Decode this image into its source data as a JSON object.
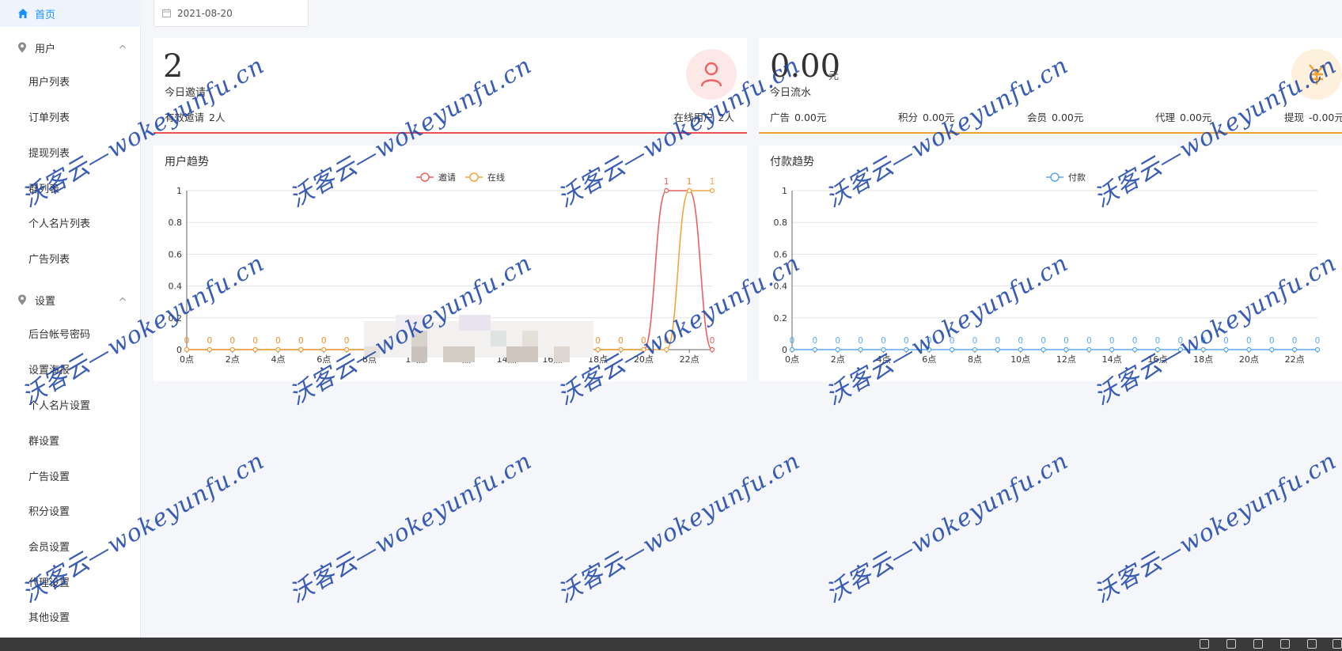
{
  "sidebar": {
    "home": "首页",
    "groups": [
      {
        "title": "用户",
        "items": [
          "用户列表",
          "订单列表",
          "提现列表",
          "群列表",
          "个人名片列表",
          "广告列表"
        ]
      },
      {
        "title": "设置",
        "items": [
          "后台帐号密码",
          "设置海报",
          "个人名片设置",
          "群设置",
          "广告设置",
          "积分设置",
          "会员设置",
          "代理设置",
          "其他设置"
        ]
      }
    ]
  },
  "date_picker": {
    "value": "2021-08-20",
    "icon": "calendar-icon"
  },
  "left_stat": {
    "value": "2",
    "label": "今日邀请",
    "rows": [
      {
        "label": "有效邀请",
        "value": "2人"
      },
      {
        "label": "在线用户",
        "value": "2人"
      }
    ],
    "icon": "user-icon",
    "accent": "#f05050"
  },
  "right_stat": {
    "value": "0.00",
    "unit": "元",
    "label": "今日流水",
    "rows": [
      {
        "label": "广告",
        "value": "0.00元"
      },
      {
        "label": "积分",
        "value": "0.00元"
      },
      {
        "label": "会员",
        "value": "0.00元"
      },
      {
        "label": "代理",
        "value": "0.00元"
      },
      {
        "label": "提现",
        "value": "-0.00元"
      }
    ],
    "icon": "yen-icon",
    "accent": "#f0a030"
  },
  "chart_data": [
    {
      "type": "line",
      "title": "用户趋势",
      "x": [
        "0点",
        "1点",
        "2点",
        "3点",
        "4点",
        "5点",
        "6点",
        "7点",
        "8点",
        "9点",
        "10点",
        "11点",
        "12点",
        "13点",
        "14点",
        "15点",
        "16点",
        "17点",
        "18点",
        "19点",
        "20点",
        "21点",
        "22点",
        "23点"
      ],
      "xticks": [
        "0点",
        "2点",
        "4点",
        "6点",
        "8点",
        "10点",
        "12点",
        "14点",
        "16点",
        "18点",
        "20点",
        "22点"
      ],
      "ylim": [
        0,
        1
      ],
      "yticks": [
        "0",
        "0.2",
        "0.4",
        "0.6",
        "0.8",
        "1"
      ],
      "legend": "top-center",
      "grid": true,
      "series": [
        {
          "name": "邀请",
          "color": "#e8625f",
          "values": [
            0,
            0,
            0,
            0,
            0,
            0,
            0,
            0,
            0,
            0,
            0,
            0,
            0,
            0,
            0,
            0,
            0,
            0,
            0,
            0,
            0,
            1,
            1,
            0
          ]
        },
        {
          "name": "在线",
          "color": "#f0a540",
          "values": [
            0,
            0,
            0,
            0,
            0,
            0,
            0,
            0,
            0,
            0,
            0,
            0,
            0,
            0,
            0,
            0,
            0,
            0,
            0,
            0,
            0,
            0,
            1,
            1
          ]
        }
      ]
    },
    {
      "type": "line",
      "title": "付款趋势",
      "x": [
        "0点",
        "1点",
        "2点",
        "3点",
        "4点",
        "5点",
        "6点",
        "7点",
        "8点",
        "9点",
        "10点",
        "11点",
        "12点",
        "13点",
        "14点",
        "15点",
        "16点",
        "17点",
        "18点",
        "19点",
        "20点",
        "21点",
        "22点",
        "23点"
      ],
      "xticks": [
        "0点",
        "2点",
        "4点",
        "6点",
        "8点",
        "10点",
        "12点",
        "14点",
        "16点",
        "18点",
        "20点",
        "22点"
      ],
      "ylim": [
        0,
        1
      ],
      "yticks": [
        "0",
        "0.2",
        "0.4",
        "0.6",
        "0.8",
        "1"
      ],
      "legend": "top-center",
      "grid": true,
      "series": [
        {
          "name": "付款",
          "color": "#5aa9f0",
          "values": [
            0,
            0,
            0,
            0,
            0,
            0,
            0,
            0,
            0,
            0,
            0,
            0,
            0,
            0,
            0,
            0,
            0,
            0,
            0,
            0,
            0,
            0,
            0,
            0
          ]
        }
      ]
    }
  ],
  "watermark": "沃客云—wokeyunfu.cn"
}
